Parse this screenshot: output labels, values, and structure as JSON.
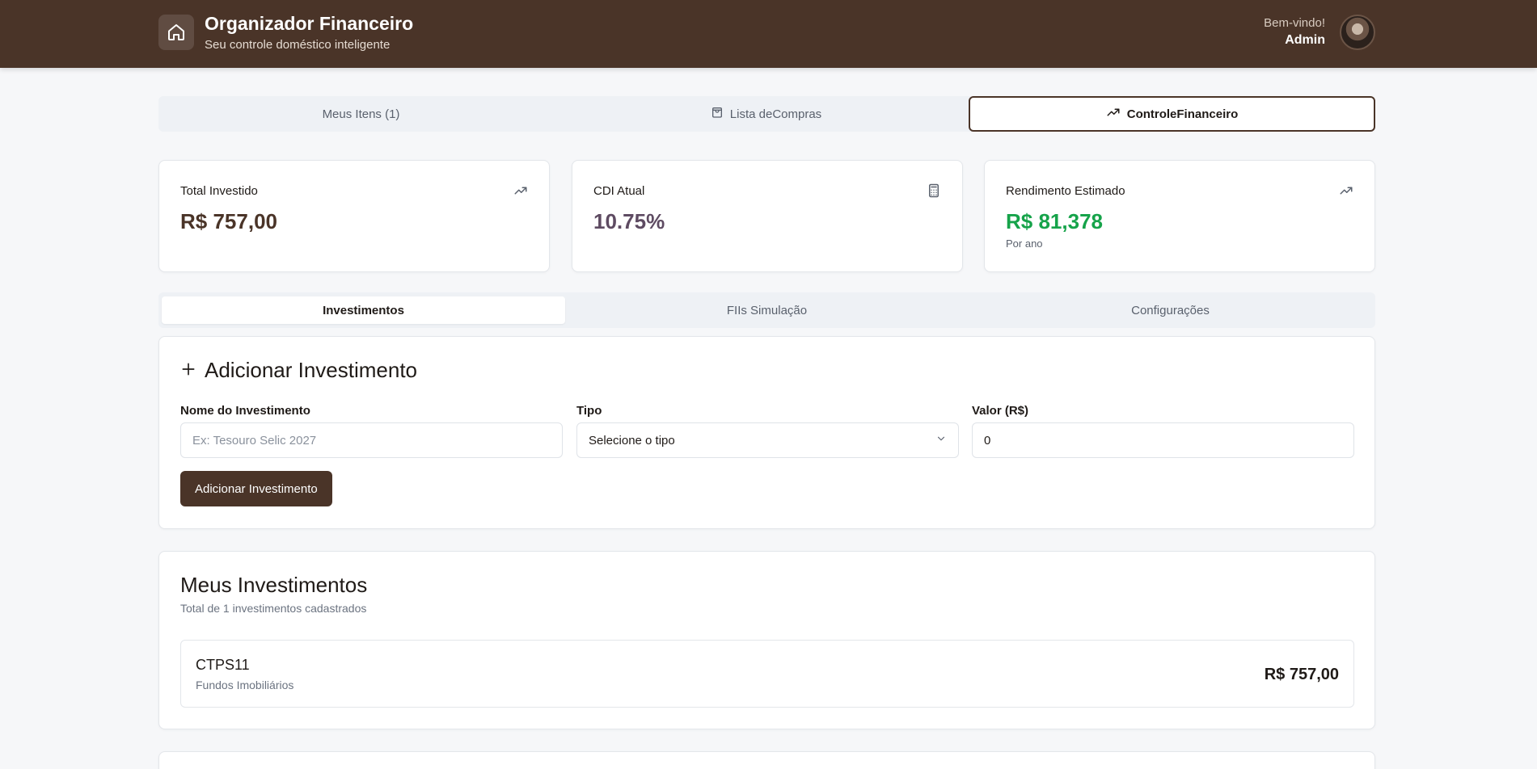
{
  "header": {
    "title": "Organizador Financeiro",
    "subtitle": "Seu controle doméstico inteligente",
    "welcome": "Bem-vindo!",
    "user": "Admin",
    "icon": "home-icon"
  },
  "main_tabs": [
    {
      "label": "Meus Itens (1)",
      "icon": ""
    },
    {
      "label": "Lista deCompras",
      "icon": "shopping-bag-icon"
    },
    {
      "label": "ControleFinanceiro",
      "icon": "trending-up-icon"
    }
  ],
  "stats": [
    {
      "label": "Total Investido",
      "value": "R$ 757,00",
      "note": "",
      "icon": "trending-up-icon",
      "color": "#4a3428"
    },
    {
      "label": "CDI Atual",
      "value": "10.75%",
      "note": "",
      "icon": "calculator-icon",
      "color": "#5e4b62"
    },
    {
      "label": "Rendimento Estimado",
      "value": "R$ 81,378",
      "note": "Por ano",
      "icon": "trending-up-icon",
      "color": "#16a34a"
    }
  ],
  "sub_tabs": [
    "Investimentos",
    "FIIs Simulação",
    "Configurações"
  ],
  "add_form": {
    "title": "Adicionar Investimento",
    "name_label": "Nome do Investimento",
    "name_placeholder": "Ex: Tesouro Selic 2027",
    "type_label": "Tipo",
    "type_value": "Selecione o tipo",
    "value_label": "Valor (R$)",
    "value_value": "0",
    "submit_label": "Adicionar Investimento"
  },
  "my_investments": {
    "title": "Meus Investimentos",
    "subtitle": "Total de 1 investimentos cadastrados",
    "items": [
      {
        "name": "CTPS11",
        "type": "Fundos Imobiliários",
        "value": "R$ 757,00"
      }
    ]
  },
  "colors": {
    "brand": "#4a3428",
    "positive": "#16a34a"
  }
}
